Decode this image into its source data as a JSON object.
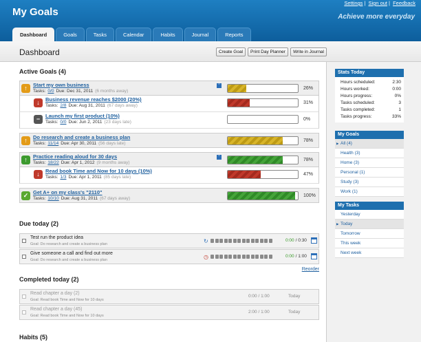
{
  "app": {
    "title": "My Goals",
    "tagline": "Achieve more everyday",
    "links": [
      "Settings",
      "Sign out",
      "Feedback"
    ]
  },
  "tabs": [
    "Dashboard",
    "Goals",
    "Tasks",
    "Calendar",
    "Habits",
    "Journal",
    "Reports"
  ],
  "page": {
    "title": "Dashboard",
    "actions": [
      "Create Goal",
      "Print Day Planner",
      "Write in Journal"
    ]
  },
  "goals_section": "Active Goals (4)",
  "goals": [
    {
      "title": "Start my own business",
      "tasks_label": "Tasks:",
      "tasks": "0/0",
      "due": "Due: Dec 31, 2011",
      "away": "(6 months away)",
      "percent": "26%",
      "progress": 26,
      "color": "yellow",
      "icon": "up-arrow-icon",
      "icon_color": "#e39b17",
      "level": 0
    },
    {
      "title": "Business revenue reaches $2000 (20%)",
      "tasks_label": "Tasks:",
      "tasks": "2/8",
      "due": "Due: Aug 31, 2011",
      "away": "(67 days away)",
      "percent": "31%",
      "progress": 31,
      "color": "red",
      "icon": "down-arrow-icon",
      "icon_color": "#c0392b",
      "level": 1
    },
    {
      "title": "Launch my first product (10%)",
      "tasks_label": "Tasks:",
      "tasks": "0/0",
      "due": "Due: Jun 2, 2011",
      "away": "(23 days late)",
      "percent": "0%",
      "progress": 0,
      "color": "red",
      "icon": "minus-icon",
      "icon_color": "#555555",
      "level": 1
    },
    {
      "title": "Do research and create a business plan",
      "tasks_label": "Tasks:",
      "tasks": "11/14",
      "due": "Due: Apr 30, 2011",
      "away": "(56 days late)",
      "percent": "78%",
      "progress": 78,
      "color": "yellow",
      "icon": "up-arrow-icon",
      "icon_color": "#e39b17",
      "level": 0
    },
    {
      "title": "Practice reading aloud for 30 days",
      "tasks_label": "Tasks:",
      "tasks": "18/22",
      "due": "Due: Apr 1, 2012",
      "away": "(9 months away)",
      "percent": "78%",
      "progress": 78,
      "color": "green",
      "icon": "up-arrow-icon",
      "icon_color": "#3c9a2e",
      "level": 0
    },
    {
      "title": "Read book Time and Now for 10 days (10%)",
      "tasks_label": "Tasks:",
      "tasks": "1/3",
      "due": "Due: Apr 1, 2011",
      "away": "(85 days late)",
      "percent": "47%",
      "progress": 47,
      "color": "red",
      "icon": "down-arrow-icon",
      "icon_color": "#c0392b",
      "level": 1
    },
    {
      "title": "Get A+ on my class's \"2110\"",
      "tasks_label": "Tasks:",
      "tasks": "10/10",
      "due": "Due: Aug 31, 2011",
      "away": "(67 days away)",
      "percent": "100%",
      "progress": 100,
      "color": "green",
      "icon": "check-icon",
      "icon_color": "#5aa830",
      "level": 0
    }
  ],
  "due_section": "Due today (2)",
  "due_tasks": [
    {
      "title": "Test run the product idea",
      "goal": "Goal: Do research and create a business plan",
      "time_done": "0:00",
      "time_total": "/ 0:30"
    },
    {
      "title": "Give someone a call and find out more",
      "goal": "Goal: Do research and create a business plan",
      "time_done": "0:00",
      "time_total": "/ 1:00"
    }
  ],
  "reorder": "Reorder",
  "completed_section": "Completed today (2)",
  "completed_tasks": [
    {
      "title": "Read chapter a day (2)",
      "goal": "Goal: Read book Time and Now for 10 days",
      "time": "0:00 / 1:00",
      "day": "Today"
    },
    {
      "title": "Read chapter a day (45)",
      "goal": "Goal: Read book Time and Now for 10 days",
      "time": "2:00 / 1:00",
      "day": "Today"
    }
  ],
  "habits_section": "Habits (5)",
  "stats": {
    "title": "Stats Today",
    "rows": [
      [
        "Hours scheduled:",
        "2:30"
      ],
      [
        "Hours worked:",
        "0:00"
      ],
      [
        "Hours progress:",
        "0%"
      ],
      [
        "Tasks scheduled:",
        "3"
      ],
      [
        "Tasks completed:",
        "1"
      ],
      [
        "Tasks progress:",
        "33%"
      ]
    ]
  },
  "my_goals": {
    "title": "My Goals",
    "items": [
      "All (4)",
      "Health (3)",
      "Home (3)",
      "Personal (1)",
      "Study (3)",
      "Work (1)"
    ]
  },
  "my_tasks": {
    "title": "My Tasks",
    "items": [
      "Yesterday",
      "Today",
      "Tomorrow",
      "This week",
      "Next week"
    ]
  }
}
